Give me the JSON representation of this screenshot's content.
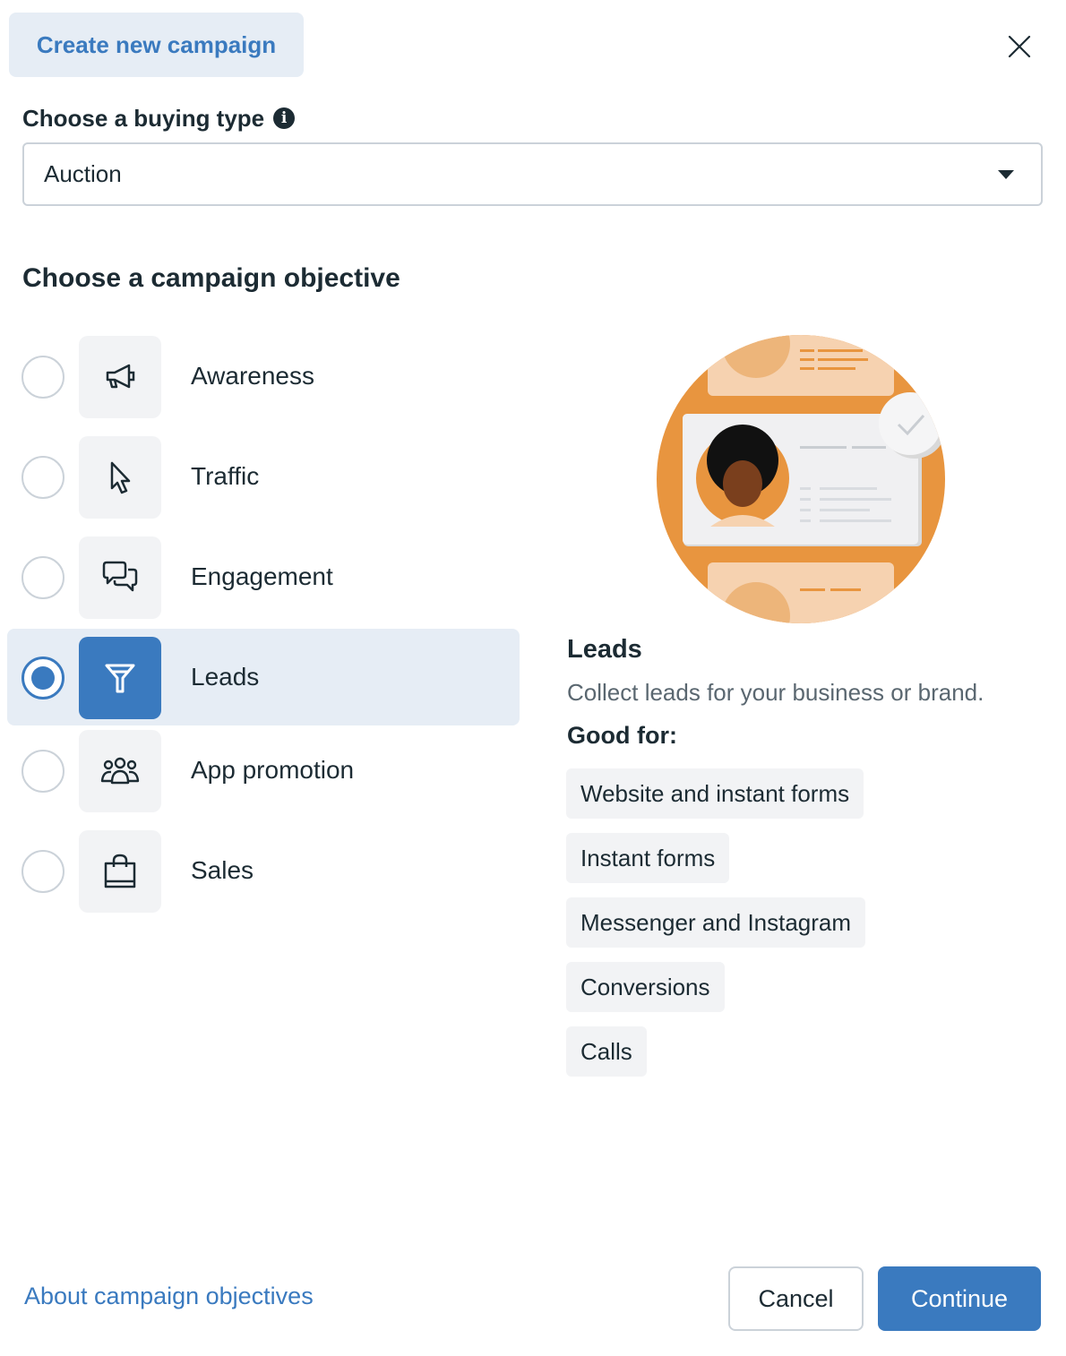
{
  "header": {
    "title": "Create new campaign"
  },
  "buying_type": {
    "label": "Choose a buying type",
    "selected": "Auction"
  },
  "objective_section": {
    "title": "Choose a campaign objective",
    "items": [
      {
        "label": "Awareness",
        "icon": "megaphone-icon",
        "selected": false
      },
      {
        "label": "Traffic",
        "icon": "cursor-icon",
        "selected": false
      },
      {
        "label": "Engagement",
        "icon": "chat-bubbles-icon",
        "selected": false
      },
      {
        "label": "Leads",
        "icon": "funnel-icon",
        "selected": true
      },
      {
        "label": "App promotion",
        "icon": "people-group-icon",
        "selected": false
      },
      {
        "label": "Sales",
        "icon": "shopping-bag-icon",
        "selected": false
      }
    ]
  },
  "detail": {
    "title": "Leads",
    "description": "Collect leads for your business or brand.",
    "good_for_label": "Good for:",
    "tags": [
      "Website and instant forms",
      "Instant forms",
      "Messenger and Instagram",
      "Conversions",
      "Calls"
    ]
  },
  "footer": {
    "about_link": "About campaign objectives",
    "cancel_label": "Cancel",
    "continue_label": "Continue"
  },
  "colors": {
    "accent": "#3a7abf",
    "selected_bg": "#e6edf5",
    "illustration_orange": "#e8953f"
  }
}
